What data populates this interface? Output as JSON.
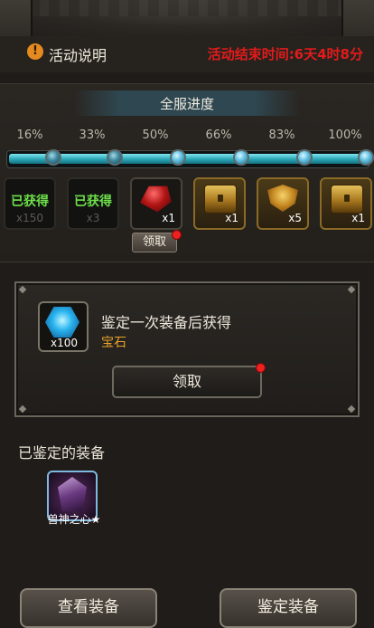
{
  "header": {
    "activity_label": "活动说明",
    "end_time": "活动结束时间:6天4时8分"
  },
  "progress": {
    "title": "全服进度",
    "fill_fraction": 1.0,
    "milestones": [
      "16%",
      "33%",
      "50%",
      "66%",
      "83%",
      "100%"
    ]
  },
  "rewards": [
    {
      "status": "已获得",
      "qty": "x150"
    },
    {
      "status": "已获得",
      "qty": "x3"
    },
    {
      "item": "ruby-gem-icon",
      "qty": "x1"
    },
    {
      "item": "treasure-chest-icon",
      "qty": "x1"
    },
    {
      "item": "gold-shield-icon",
      "qty": "x5"
    },
    {
      "item": "treasure-chest-icon",
      "qty": "x1"
    }
  ],
  "claim_small_label": "领取",
  "task": {
    "gem_qty": "x100",
    "description": "鉴定一次装备后获得",
    "reward_name": "宝石",
    "claim_label": "领取"
  },
  "appraised": {
    "label": "已鉴定的装备",
    "item_name": "兽神之心★"
  },
  "buttons": {
    "view_label": "查看装备",
    "appraise_label": "鉴定装备"
  },
  "colors": {
    "end_time": "#e11b1b",
    "claimed": "#6ee04a",
    "reward_name": "#e8a22a",
    "notify_dot": "#ef2020"
  }
}
